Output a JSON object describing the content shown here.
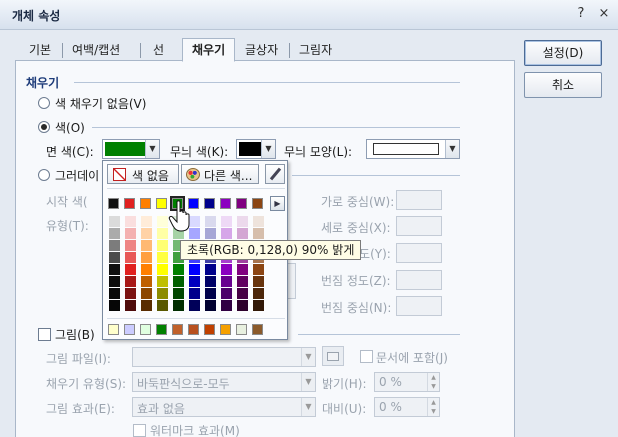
{
  "window": {
    "title": "개체 속성",
    "help_label": "?",
    "close_label": "×"
  },
  "tabs": [
    {
      "label": "기본"
    },
    {
      "label": "여백/캡션"
    },
    {
      "label": "선"
    },
    {
      "label": "채우기"
    },
    {
      "label": "글상자"
    },
    {
      "label": "그림자"
    }
  ],
  "active_tab": "채우기",
  "buttons": {
    "ok": "설정(D)",
    "cancel": "취소"
  },
  "fill": {
    "group_title": "채우기",
    "no_fill_label": "색 채우기 없음(V)",
    "color_label": "색(O)",
    "face_color_label": "면 색(C):",
    "pattern_color_label": "무늬 색(K):",
    "pattern_shape_label": "무늬 모양(L):",
    "face_color": "#008000",
    "pattern_color": "#000000",
    "gradient_label": "그러데이",
    "start_color_label": "시작 색(",
    "type_label": "유형(T):",
    "h_center_label": "가로 중심(W):",
    "v_center_label": "세로 중심(X):",
    "angle_label": "각도(Y):",
    "blur_degree_label": "번짐 정도(Z):",
    "blur_center_label": "번짐 중심(N):"
  },
  "picture": {
    "label": "그림(B)",
    "file_label": "그림 파일(I):",
    "include_doc_label": "문서에 포함(J)",
    "fill_type_label": "채우기 유형(S):",
    "fill_type_value": "바둑판식으로-모두",
    "effect_label": "그림 효과(E):",
    "effect_value": "효과 없음",
    "brightness_label": "밝기(H):",
    "brightness_value": "0 %",
    "contrast_label": "대비(U):",
    "contrast_value": "0 %",
    "watermark_label": "워터마크 효과(M)"
  },
  "palette": {
    "no_color_label": "색 없음",
    "other_colors_label": "다른 색...",
    "theme_colors": [
      "#101010",
      "#e02020",
      "#ff7f00",
      "#ffff00",
      "#008000",
      "#0000ff",
      "#00008b",
      "#8b00c0",
      "#800080",
      "#8b4513"
    ],
    "recent_colors": [
      "#ffffcc",
      "#ccccff",
      "#e0ffe0",
      "#008000",
      "#c0602a",
      "#b8501f",
      "#c04000",
      "#f5a000",
      "#e8f0e0",
      "#8b5a2b"
    ],
    "tooltip": "초록(RGB: 0,128,0) 90% 밝게"
  }
}
